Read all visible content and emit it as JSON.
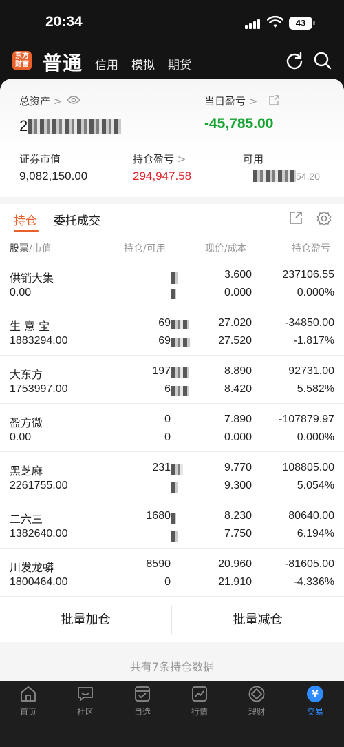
{
  "status_bar": {
    "time": "20:34",
    "battery": "43"
  },
  "app_header": {
    "logo_text": "东方财富",
    "mode": "普通",
    "tabs": [
      "信用",
      "模拟",
      "期货"
    ]
  },
  "summary": {
    "total_assets_label": "总资产",
    "total_assets_value": "2",
    "daily_pnl_label": "当日盈亏",
    "daily_pnl_value": "-45,785.00",
    "market_value_label": "证券市值",
    "market_value_value": "9,082,150.00",
    "position_pnl_label": "持仓盈亏",
    "position_pnl_value": "294,947.58",
    "available_label": "可用",
    "available_value": "54.20"
  },
  "position_tabs": {
    "holdings": "持仓",
    "orders": "委托成交"
  },
  "columns": {
    "stock_bold": "股票",
    "stock_rest": "/市值",
    "position_bold": "持仓",
    "position_rest": "/可用",
    "price_bold": "现价",
    "price_rest": "/成本",
    "pnl": "持仓盈亏"
  },
  "holdings": [
    {
      "name": "供销大集",
      "market_value": "0.00",
      "position": "",
      "available": "",
      "price": "3.600",
      "cost": "0.000",
      "pnl": "237106.55",
      "pnl_pct": "0.000%",
      "pnl_color": "red",
      "pct_color": "red"
    },
    {
      "name": "生 意 宝",
      "market_value": "1883294.00",
      "position": "69",
      "available": "69",
      "price": "27.020",
      "cost": "27.520",
      "pnl": "-34850.00",
      "pnl_pct": "-1.817%",
      "pnl_color": "green",
      "pct_color": "green"
    },
    {
      "name": "大东方",
      "market_value": "1753997.00",
      "position": "197",
      "available": "6",
      "price": "8.890",
      "cost": "8.420",
      "pnl": "92731.00",
      "pnl_pct": "5.582%",
      "pnl_color": "red",
      "pct_color": "red"
    },
    {
      "name": "盈方微",
      "market_value": "0.00",
      "position": "0",
      "available": "0",
      "price": "7.890",
      "cost": "0.000",
      "pnl": "-107879.97",
      "pnl_pct": "0.000%",
      "pnl_color": "green",
      "pct_color": "green"
    },
    {
      "name": "黑芝麻",
      "market_value": "2261755.00",
      "position": "231",
      "available": "",
      "price": "9.770",
      "cost": "9.300",
      "pnl": "108805.00",
      "pnl_pct": "5.054%",
      "pnl_color": "red",
      "pct_color": "red"
    },
    {
      "name": "二六三",
      "market_value": "1382640.00",
      "position": "1680",
      "available": "",
      "price": "8.230",
      "cost": "7.750",
      "pnl": "80640.00",
      "pnl_pct": "6.194%",
      "pnl_color": "red",
      "pct_color": "red"
    },
    {
      "name": "川发龙蟒",
      "market_value": "1800464.00",
      "position": "8590",
      "available": "0",
      "price": "20.960",
      "cost": "21.910",
      "pnl": "-81605.00",
      "pnl_pct": "-4.336%",
      "pnl_color": "green",
      "pct_color": "green"
    }
  ],
  "batch": {
    "add": "批量加仓",
    "reduce": "批量减仓"
  },
  "footer_text": "共有7条持仓数据",
  "bottom_nav": [
    {
      "label": "首页",
      "icon": "home-icon"
    },
    {
      "label": "社区",
      "icon": "community-icon"
    },
    {
      "label": "自选",
      "icon": "watchlist-icon"
    },
    {
      "label": "行情",
      "icon": "market-icon"
    },
    {
      "label": "理财",
      "icon": "wealth-icon"
    },
    {
      "label": "交易",
      "icon": "trade-icon"
    }
  ],
  "colors": {
    "accent": "#e8602a",
    "up": "#e0212b",
    "down": "#14a330",
    "nav_active": "#2f8cff"
  }
}
